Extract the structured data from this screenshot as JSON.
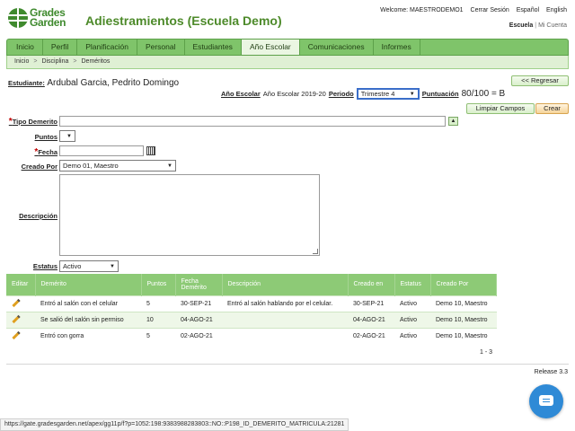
{
  "brand": {
    "line1": "Grades",
    "line2": "Garden"
  },
  "app_title": "Adiestramientos (Escuela Demo)",
  "topbar": {
    "welcome": "Welcome: MAESTRODEMO1",
    "logout": "Cerrar Sesión",
    "lang_es": "Español",
    "lang_en": "English"
  },
  "subnav": {
    "school": "Escuela",
    "sep": "|",
    "account": "Mi Cuenta"
  },
  "menu": [
    {
      "label": "Inicio"
    },
    {
      "label": "Perfil"
    },
    {
      "label": "Planificación"
    },
    {
      "label": "Personal"
    },
    {
      "label": "Estudiantes"
    },
    {
      "label": "Año Escolar"
    },
    {
      "label": "Comunicaciones"
    },
    {
      "label": "Informes"
    }
  ],
  "breadcrumb": [
    "Inicio",
    "Disciplina",
    "Deméritos"
  ],
  "student": {
    "label": "Estudiante:",
    "name": "Ardubal Garcia, Pedrito Domingo"
  },
  "buttons": {
    "back": "<< Regresar",
    "clear": "Limpiar Campos",
    "create": "Crear"
  },
  "year": {
    "label": "Año Escolar",
    "value": "Año Escolar 2019-20",
    "period_label": "Periodo",
    "period_value": "Trimestre 4",
    "score_label": "Puntuación",
    "score_value": "80/100 = B"
  },
  "form": {
    "tipo_label": "Tipo Demerito",
    "puntos_label": "Puntos",
    "fecha_label": "Fecha",
    "creado_por_label": "Creado Por",
    "creado_por_value": "Demo 01, Maestro",
    "descripcion_label": "Descripción",
    "estatus_label": "Estatus",
    "estatus_value": "Activo",
    "required_mark": "*"
  },
  "table": {
    "headers": [
      "Editar",
      "Demérito",
      "Puntos",
      "Fecha Demérito",
      "Descripción",
      "Creado en",
      "Estatus",
      "Creado Por"
    ],
    "rows": [
      [
        "Entró al salón con el celular",
        "5",
        "30-SEP-21",
        "Entró al salón hablando por el celular.",
        "30-SEP-21",
        "Activo",
        "Demo 10, Maestro"
      ],
      [
        "Se salió del salón sin permiso",
        "10",
        "04-AGO-21",
        "",
        "04-AGO-21",
        "Activo",
        "Demo 10, Maestro"
      ],
      [
        "Entró con gorra",
        "5",
        "02-AGO-21",
        "",
        "02-AGO-21",
        "Activo",
        "Demo 10, Maestro"
      ]
    ],
    "count": "1 - 3"
  },
  "release": "Release 3.3",
  "status_url": "https://gate.gradesgarden.net/apex/gg11p/f?p=1052:198:9383988283803::NO::P198_ID_DEMERITO_MATRICULA:21281",
  "colors": {
    "accent": "#7fc46a",
    "title": "#4d8a2a",
    "chat": "#2f8ad6"
  }
}
